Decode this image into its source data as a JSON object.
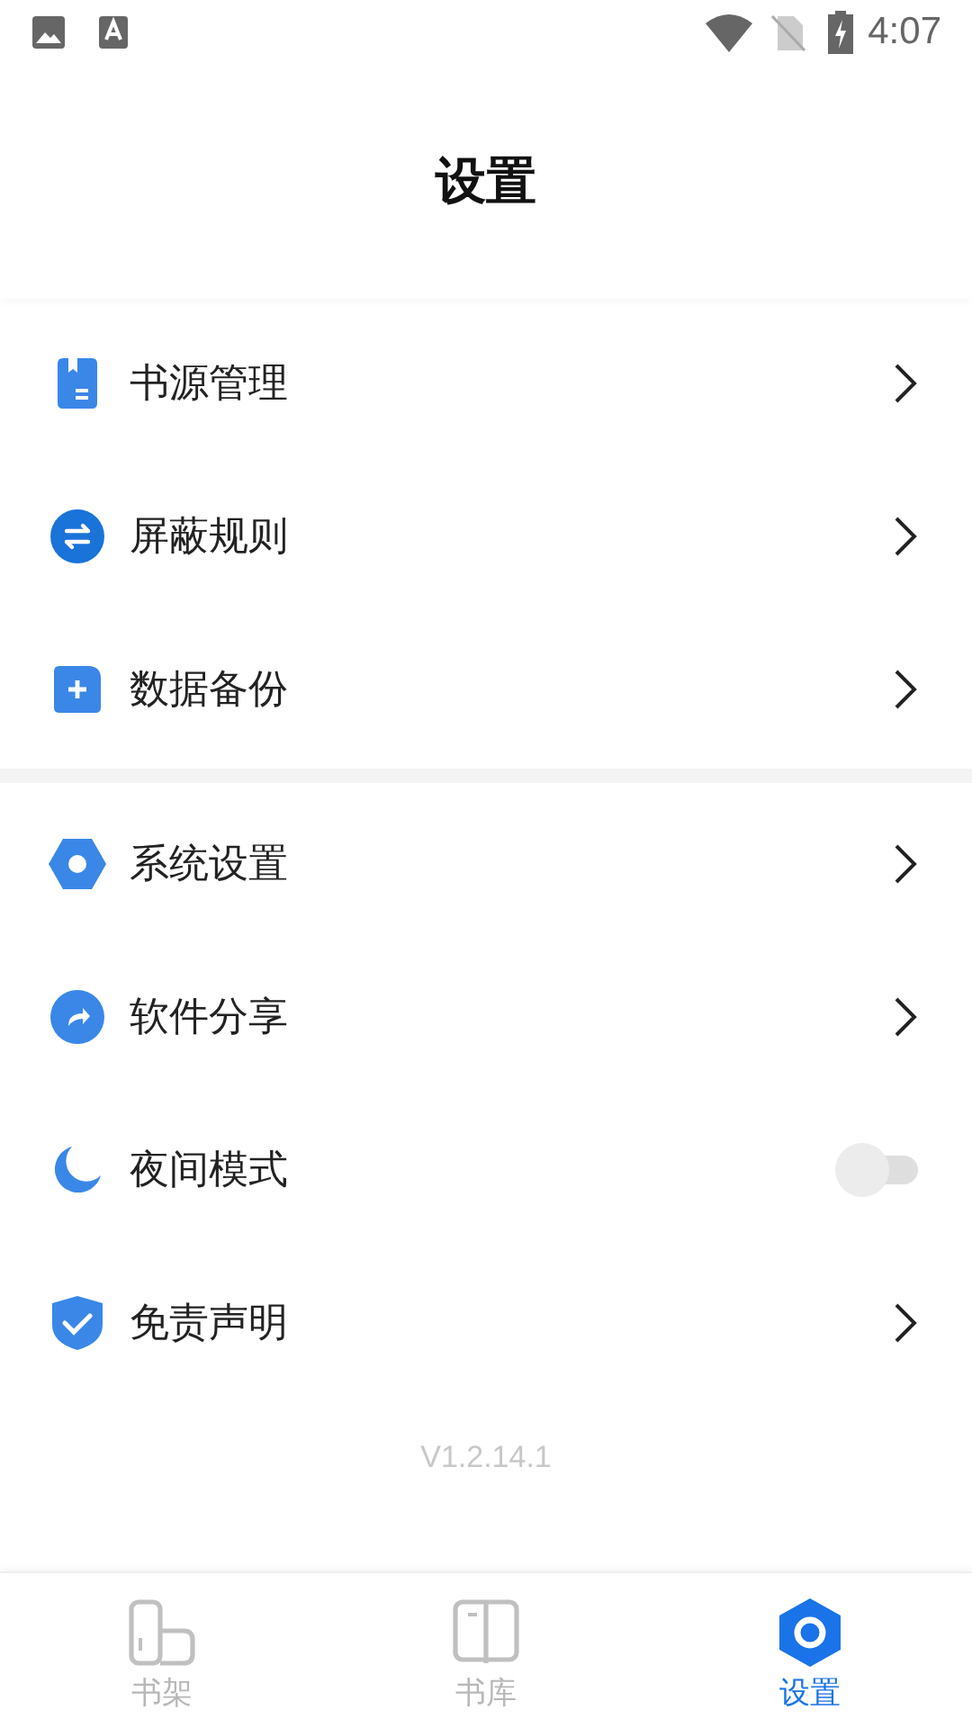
{
  "status_bar": {
    "time": "4:07"
  },
  "header": {
    "title": "设置"
  },
  "sections": [
    {
      "items": [
        {
          "label": "书源管理",
          "kind": "link"
        },
        {
          "label": "屏蔽规则",
          "kind": "link"
        },
        {
          "label": "数据备份",
          "kind": "link"
        }
      ]
    },
    {
      "items": [
        {
          "label": "系统设置",
          "kind": "link"
        },
        {
          "label": "软件分享",
          "kind": "link"
        },
        {
          "label": "夜间模式",
          "kind": "switch",
          "on": false
        },
        {
          "label": "免责声明",
          "kind": "link"
        }
      ]
    }
  ],
  "version": "V1.2.14.1",
  "bottom_nav": [
    {
      "label": "书架",
      "selected": false
    },
    {
      "label": "书库",
      "selected": false
    },
    {
      "label": "设置",
      "selected": true
    }
  ]
}
